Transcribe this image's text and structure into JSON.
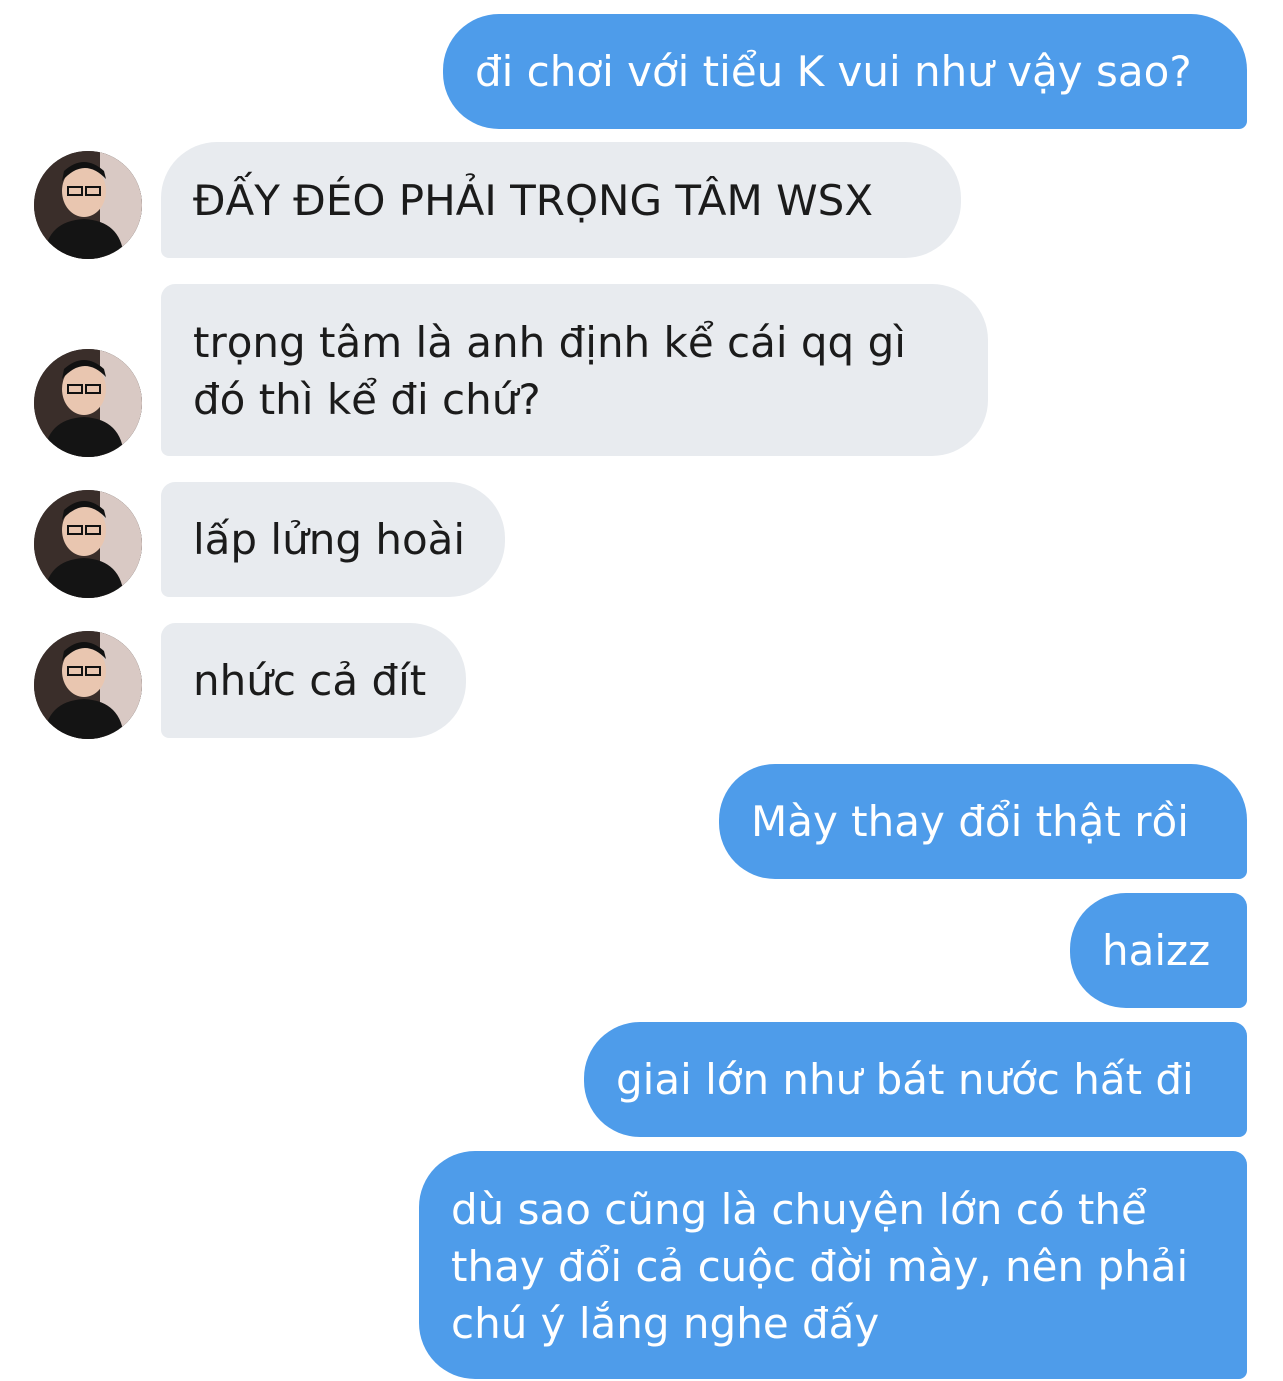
{
  "messages": [
    {
      "direction": "outgoing",
      "lines": [
        "đi chơi với tiểu K vui như vậy sao?"
      ]
    },
    {
      "direction": "incoming",
      "lines": [
        "ĐẤY ĐÉO PHẢI TRỌNG TÂM WSX"
      ],
      "avatar": "avatar-icon"
    },
    {
      "direction": "incoming",
      "lines": [
        "trọng tâm là anh định kể cái qq gì",
        "đó thì kể đi chứ?"
      ],
      "avatar": "avatar-icon"
    },
    {
      "direction": "incoming",
      "lines": [
        "lấp lửng hoài"
      ],
      "avatar": "avatar-icon"
    },
    {
      "direction": "incoming",
      "lines": [
        "nhức cả đít"
      ],
      "avatar": "avatar-icon"
    },
    {
      "direction": "outgoing",
      "lines": [
        "Mày thay đổi thật rồi"
      ]
    },
    {
      "direction": "outgoing",
      "lines": [
        "haizz"
      ]
    },
    {
      "direction": "outgoing",
      "lines": [
        "giai lớn như bát nước hất đi"
      ]
    },
    {
      "direction": "outgoing",
      "lines": [
        "dù sao cũng là chuyện lớn có thể",
        "thay đổi cả cuộc đời mày, nên phải",
        "chú ý lắng nghe đấy"
      ]
    }
  ],
  "colors": {
    "outgoing_bubble": "#4e9cea",
    "incoming_bubble": "#e8ebef",
    "outgoing_text": "#ffffff",
    "incoming_text": "#1b1b1b"
  }
}
